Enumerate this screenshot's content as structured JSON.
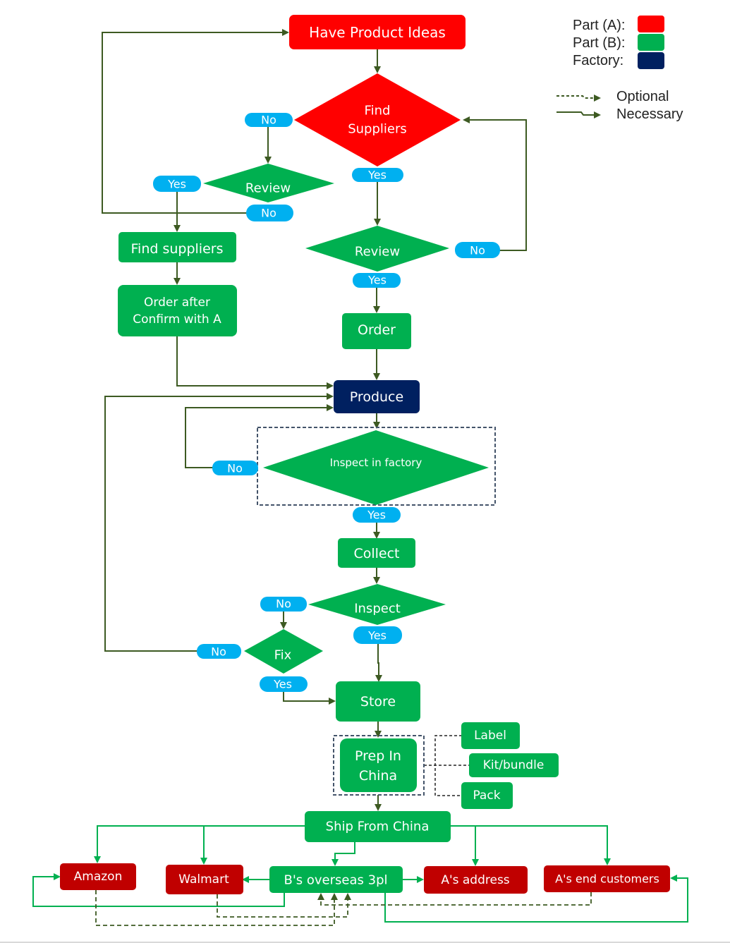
{
  "colors": {
    "part_a": "#ff0000",
    "part_b": "#00b050",
    "factory": "#002060",
    "dest_red": "#c00000",
    "yes_no_badge": "#00b0f0",
    "arrow_dark": "#3d5a22",
    "arrow_green": "#00b050",
    "dash_box": "#44546a"
  },
  "legend": {
    "part_a": "Part (A):",
    "part_b": "Part (B):",
    "factory": "Factory:",
    "optional": "Optional",
    "necessary": "Necessary"
  },
  "nodes": {
    "have_product_ideas": "Have Product Ideas",
    "find_suppliers_a_line1": "Find",
    "find_suppliers_a_line2": "Suppliers",
    "review_left": "Review",
    "review_right": "Review",
    "find_suppliers_b": "Find suppliers",
    "order_after_line1": "Order after",
    "order_after_line2": "Confirm with A",
    "order": "Order",
    "produce": "Produce",
    "inspect_in_factory": "Inspect in factory",
    "collect": "Collect",
    "inspect": "Inspect",
    "fix": "Fix",
    "store": "Store",
    "prep_line1": "Prep In",
    "prep_line2": "China",
    "label": "Label",
    "kit_bundle": "Kit/bundle",
    "pack": "Pack",
    "ship_from_china": "Ship From China",
    "amazon": "Amazon",
    "walmart": "Walmart",
    "b_overseas_3pl": "B's overseas 3pl",
    "a_address": "A's address",
    "a_end_customers": "A's end customers"
  },
  "badges": {
    "no_find": "No",
    "yes_find": "Yes",
    "yes_review_left": "Yes",
    "no_review_left": "No",
    "no_review_right": "No",
    "yes_review_right": "Yes",
    "no_inspect_factory": "No",
    "yes_inspect_factory": "Yes",
    "no_inspect": "No",
    "yes_inspect": "Yes",
    "no_fix": "No",
    "yes_fix": "Yes"
  }
}
